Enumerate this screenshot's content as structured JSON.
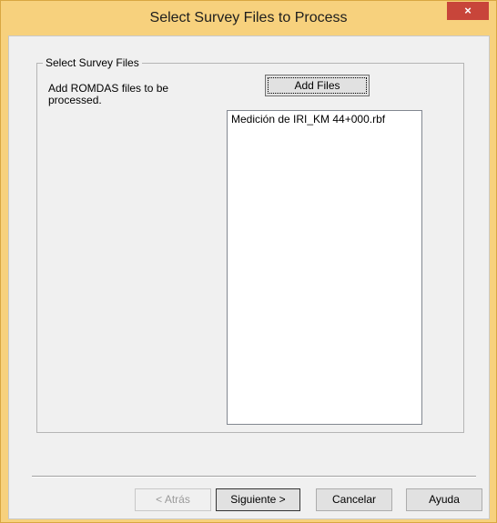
{
  "window": {
    "title": "Select Survey Files to Process",
    "close_glyph": "×"
  },
  "group": {
    "label": "Select Survey Files",
    "description": "Add ROMDAS files to be processed.",
    "add_files_label": "Add Files",
    "files": [
      "Medición de IRI_KM 44+000.rbf"
    ]
  },
  "buttons": {
    "back": "< Atrás",
    "next": "Siguiente >",
    "cancel": "Cancelar",
    "help": "Ayuda"
  },
  "colors": {
    "titlebar": "#f7d17d",
    "close": "#c8453a",
    "client": "#f0f0f0"
  }
}
